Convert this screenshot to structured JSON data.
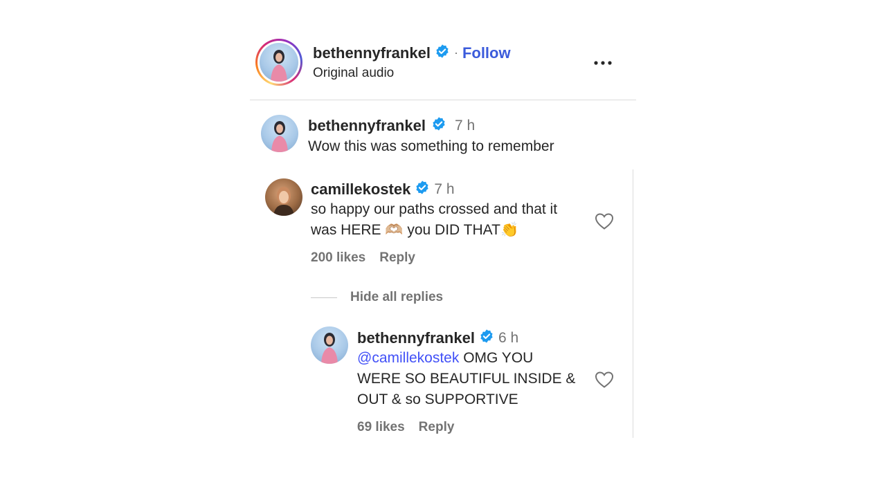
{
  "header": {
    "username": "bethennyfrankel",
    "separator": "·",
    "follow_label": "Follow",
    "subtitle": "Original audio",
    "more_label": "•••"
  },
  "caption": {
    "username": "bethennyfrankel",
    "time": "7 h",
    "text": "Wow this was something to remember"
  },
  "comments": [
    {
      "username": "camillekostek",
      "time": "7 h",
      "text_line1": "so happy our paths crossed and that it",
      "text_line2_a": "was HERE ",
      "emoji_hands": "🫶🏼",
      "text_line2_b": " you DID THAT",
      "emoji_clap": "👏",
      "likes": "200 likes",
      "reply_label": "Reply",
      "hide_replies_label": "Hide all replies"
    }
  ],
  "replies": [
    {
      "username": "bethennyfrankel",
      "time": "6 h",
      "mention": "@camillekostek",
      "text_line1_rest": " OMG YOU",
      "text_line2": "WERE SO BEAUTIFUL INSIDE &",
      "text_line3": "OUT & so SUPPORTIVE",
      "likes": "69 likes",
      "reply_label": "Reply"
    }
  ],
  "icons": {
    "verified": "verified-badge-icon",
    "heart": "heart-outline-icon",
    "more": "more-options-icon"
  },
  "colors": {
    "verified": "#1d9bf0",
    "follow": "#3b5bdb",
    "mention": "#4150f7",
    "muted": "#737373"
  }
}
